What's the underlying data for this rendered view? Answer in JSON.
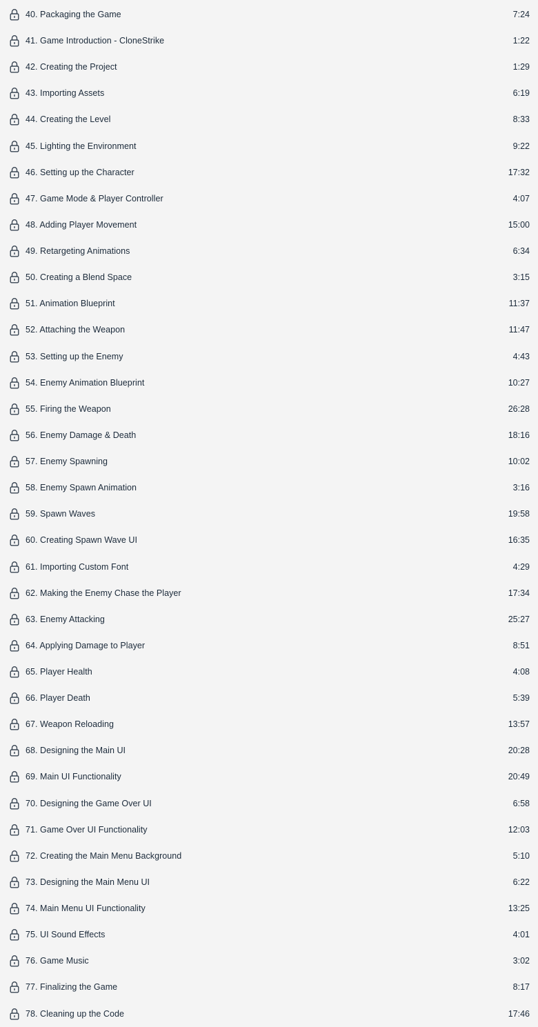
{
  "lessons": [
    {
      "number": "40.",
      "title": "Packaging the Game",
      "duration": "7:24",
      "icon": "lock-icon"
    },
    {
      "number": "41.",
      "title": "Game Introduction - CloneStrike",
      "duration": "1:22",
      "icon": "lock-icon"
    },
    {
      "number": "42.",
      "title": "Creating the Project",
      "duration": "1:29",
      "icon": "lock-icon"
    },
    {
      "number": "43.",
      "title": "Importing Assets",
      "duration": "6:19",
      "icon": "lock-icon"
    },
    {
      "number": "44.",
      "title": "Creating the Level",
      "duration": "8:33",
      "icon": "lock-icon"
    },
    {
      "number": "45.",
      "title": "Lighting the Environment",
      "duration": "9:22",
      "icon": "lock-icon"
    },
    {
      "number": "46.",
      "title": "Setting up the Character",
      "duration": "17:32",
      "icon": "lock-icon"
    },
    {
      "number": "47.",
      "title": "Game Mode & Player Controller",
      "duration": "4:07",
      "icon": "lock-icon"
    },
    {
      "number": "48.",
      "title": "Adding Player Movement",
      "duration": "15:00",
      "icon": "lock-icon"
    },
    {
      "number": "49.",
      "title": "Retargeting Animations",
      "duration": "6:34",
      "icon": "lock-icon"
    },
    {
      "number": "50.",
      "title": "Creating a Blend Space",
      "duration": "3:15",
      "icon": "lock-icon"
    },
    {
      "number": "51.",
      "title": "Animation Blueprint",
      "duration": "11:37",
      "icon": "lock-icon"
    },
    {
      "number": "52.",
      "title": "Attaching the Weapon",
      "duration": "11:47",
      "icon": "lock-icon"
    },
    {
      "number": "53.",
      "title": "Setting up the Enemy",
      "duration": "4:43",
      "icon": "lock-icon"
    },
    {
      "number": "54.",
      "title": "Enemy Animation Blueprint",
      "duration": "10:27",
      "icon": "lock-icon"
    },
    {
      "number": "55.",
      "title": "Firing the Weapon",
      "duration": "26:28",
      "icon": "lock-icon"
    },
    {
      "number": "56.",
      "title": "Enemy Damage & Death",
      "duration": "18:16",
      "icon": "lock-icon"
    },
    {
      "number": "57.",
      "title": "Enemy Spawning",
      "duration": "10:02",
      "icon": "lock-icon"
    },
    {
      "number": "58.",
      "title": "Enemy Spawn Animation",
      "duration": "3:16",
      "icon": "lock-icon"
    },
    {
      "number": "59.",
      "title": "Spawn Waves",
      "duration": "19:58",
      "icon": "lock-icon"
    },
    {
      "number": "60.",
      "title": "Creating Spawn Wave UI",
      "duration": "16:35",
      "icon": "lock-icon"
    },
    {
      "number": "61.",
      "title": "Importing Custom Font",
      "duration": "4:29",
      "icon": "lock-icon"
    },
    {
      "number": "62.",
      "title": "Making the Enemy Chase the Player",
      "duration": "17:34",
      "icon": "lock-icon"
    },
    {
      "number": "63.",
      "title": "Enemy Attacking",
      "duration": "25:27",
      "icon": "lock-icon"
    },
    {
      "number": "64.",
      "title": "Applying Damage to Player",
      "duration": "8:51",
      "icon": "lock-icon"
    },
    {
      "number": "65.",
      "title": "Player Health",
      "duration": "4:08",
      "icon": "lock-icon"
    },
    {
      "number": "66.",
      "title": "Player Death",
      "duration": "5:39",
      "icon": "lock-icon"
    },
    {
      "number": "67.",
      "title": "Weapon Reloading",
      "duration": "13:57",
      "icon": "lock-icon"
    },
    {
      "number": "68.",
      "title": "Designing the Main UI",
      "duration": "20:28",
      "icon": "lock-icon"
    },
    {
      "number": "69.",
      "title": "Main UI Functionality",
      "duration": "20:49",
      "icon": "lock-icon"
    },
    {
      "number": "70.",
      "title": "Designing the Game Over UI",
      "duration": "6:58",
      "icon": "lock-icon"
    },
    {
      "number": "71.",
      "title": "Game Over UI Functionality",
      "duration": "12:03",
      "icon": "lock-icon"
    },
    {
      "number": "72.",
      "title": "Creating the Main Menu Background",
      "duration": "5:10",
      "icon": "lock-icon"
    },
    {
      "number": "73.",
      "title": "Designing the Main Menu UI",
      "duration": "6:22",
      "icon": "lock-icon"
    },
    {
      "number": "74.",
      "title": "Main Menu UI Functionality",
      "duration": "13:25",
      "icon": "lock-icon"
    },
    {
      "number": "75.",
      "title": "UI Sound Effects",
      "duration": "4:01",
      "icon": "lock-icon"
    },
    {
      "number": "76.",
      "title": "Game Music",
      "duration": "3:02",
      "icon": "lock-icon"
    },
    {
      "number": "77.",
      "title": "Finalizing the Game",
      "duration": "8:17",
      "icon": "lock-icon"
    },
    {
      "number": "78.",
      "title": "Cleaning up the Code",
      "duration": "17:46",
      "icon": "lock-icon"
    }
  ],
  "colors": {
    "background": "#f4f4f4",
    "text": "#1b2a3a",
    "icon": "#3a4654"
  }
}
